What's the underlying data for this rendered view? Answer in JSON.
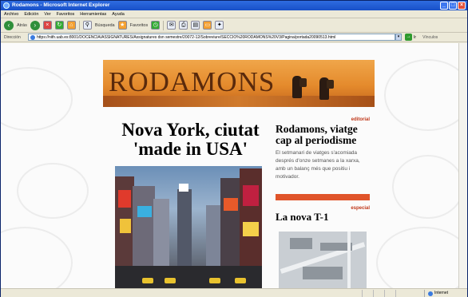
{
  "window": {
    "title": "Rodamons - Microsoft Internet Explorer",
    "controls": [
      "_",
      "□",
      "×"
    ]
  },
  "menu": [
    "Archivo",
    "Edición",
    "Ver",
    "Favoritos",
    "Herramientas",
    "Ayuda"
  ],
  "toolbar": {
    "back": "Atrás",
    "search": "Búsqueda",
    "favorites": "Favoritos"
  },
  "address": {
    "label": "Dirección",
    "url": "https://nith.uab.es:8001/DOCENCIA/ASSIGNATURES/Assignatures dsn semestre/20072-12/Sobreviure/SECCIO%20RODAMONS%20V3/Pagina/portada20090513.html",
    "go": "Ir",
    "links": "Vínculos"
  },
  "page": {
    "banner": "RODAMONS",
    "headline": "Nova York, ciutat 'made in USA'",
    "sections": [
      {
        "kicker": "editorial",
        "title": "Rodamons, viatge cap al periodisme",
        "body": "El setmanari de viatges s'acomiada després d'onze setmanes a la xarxa, amb un balanç més que positiu i motivador."
      },
      {
        "kicker": "especial",
        "title": "La nova T-1"
      }
    ]
  },
  "status": {
    "zone": "Internet"
  },
  "icons": [
    "ie-icon",
    "back-icon",
    "forward-icon",
    "stop-icon",
    "refresh-icon",
    "home-icon",
    "search-icon",
    "favorites-icon",
    "history-icon",
    "mail-icon",
    "print-icon",
    "edit-icon",
    "globe-icon"
  ]
}
